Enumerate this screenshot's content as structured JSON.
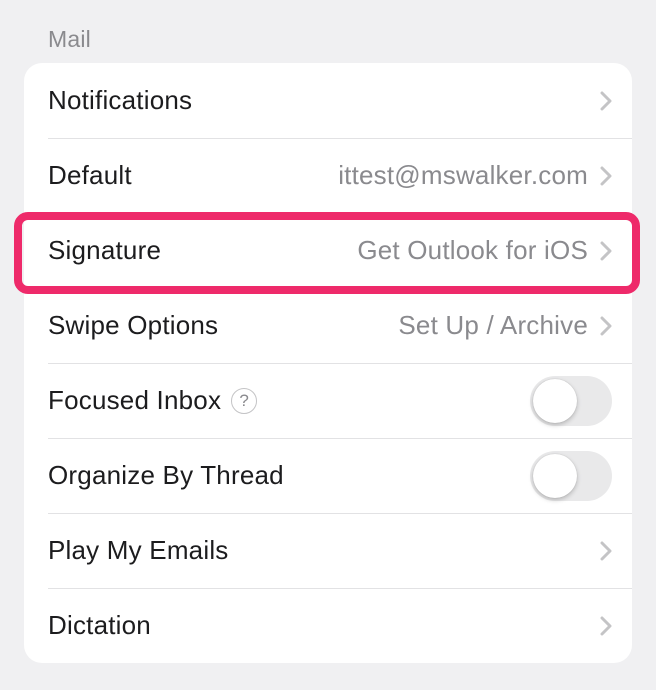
{
  "section": {
    "title": "Mail"
  },
  "rows": {
    "notifications": {
      "label": "Notifications"
    },
    "default": {
      "label": "Default",
      "value": "ittest@mswalker.com"
    },
    "signature": {
      "label": "Signature",
      "value": "Get Outlook for iOS"
    },
    "swipe": {
      "label": "Swipe Options",
      "value": "Set Up / Archive"
    },
    "focused": {
      "label": "Focused Inbox",
      "on": false
    },
    "thread": {
      "label": "Organize By Thread",
      "on": false
    },
    "playmy": {
      "label": "Play My Emails"
    },
    "dictation": {
      "label": "Dictation"
    }
  }
}
